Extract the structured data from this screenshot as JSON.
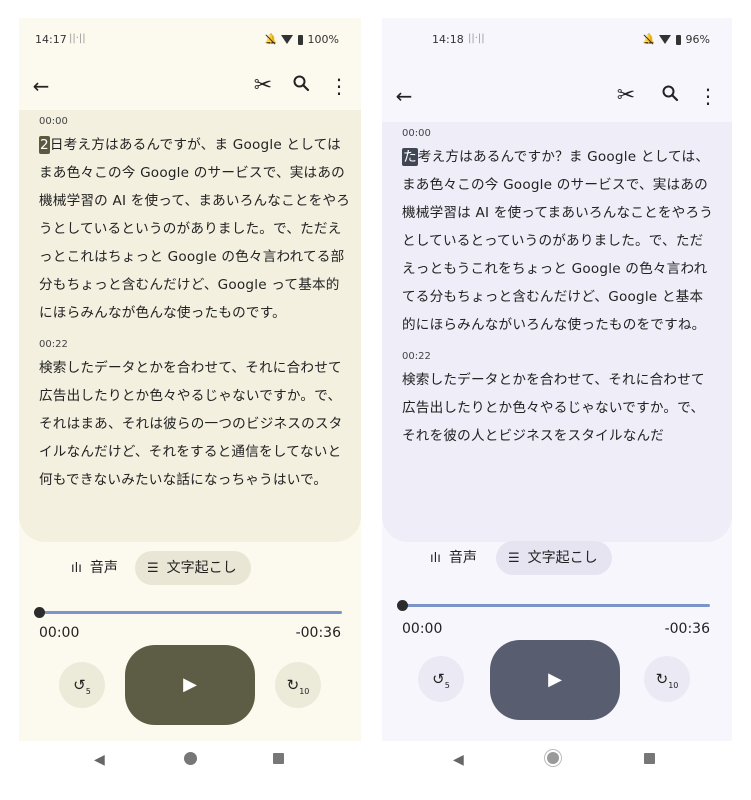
{
  "left": {
    "status": {
      "time": "14:17",
      "vibrate": "||·||",
      "battery": "100%"
    },
    "icons": {
      "back": "arrow-left-icon",
      "cut": "scissors-icon",
      "search": "search-icon",
      "more": "more-vert-icon"
    },
    "segments": [
      {
        "time": "00:00",
        "highlight": "2",
        "text": "日考え方はあるんですが、ま Google としてはまあ色々この今 Google のサービスで、実はあの機械学習の AI を使って、まあいろんなことをやろうとしているというのがありました。で、ただえっとこれはちょっと Google の色々言われてる部分もちょっと含むんだけど、Google って基本的にほらみんなが色んな使ったものです。"
      },
      {
        "time": "00:22",
        "highlight": "",
        "text": "検索したデータとかを合わせて、それに合わせて広告出したりとか色々やるじゃないですか。で、それはまあ、それは彼らの一つのビジネスのスタイルなんだけど、それをすると通信をしてないと何もできないみたいな話になっちゃうはいで。"
      }
    ],
    "tabs": {
      "audio": "音声",
      "transcript": "文字起こし"
    },
    "player": {
      "current": "00:00",
      "remaining": "-00:36",
      "progress": 0.0,
      "rewind_label": "5",
      "forward_label": "10"
    }
  },
  "right": {
    "status": {
      "time": "14:18",
      "vibrate": "||·||",
      "battery": "96%"
    },
    "icons": {
      "back": "arrow-left-icon",
      "cut": "scissors-icon",
      "search": "search-icon",
      "more": "more-vert-icon"
    },
    "segments": [
      {
        "time": "00:00",
        "highlight": "た",
        "text": "考え方はあるんですか？ま Google としては、まあ色々この今 Google のサービスで、実はあの機械学習は AI を使ってまあいろんなことをやろうとしているとっていうのがありました。で、ただえっともうこれをちょっと Google の色々言われてる分もちょっと含むんだけど、Google と基本的にほらみんながいろんな使ったものをですね。"
      },
      {
        "time": "00:22",
        "highlight": "",
        "text": "検索したデータとかを合わせて、それに合わせて広告出したりとか色々やるじゃないですか。で、それを彼の人とビジネスをスタイルなんだ"
      }
    ],
    "tabs": {
      "audio": "音声",
      "transcript": "文字起こし"
    },
    "player": {
      "current": "00:00",
      "remaining": "-00:36",
      "progress": 0.0,
      "rewind_label": "5",
      "forward_label": "10"
    }
  },
  "colors": {
    "left_bg": "#fcfaee",
    "left_card": "#f3f0e0",
    "left_play": "#5d5d45",
    "right_bg": "#f8f6fd",
    "right_card": "#efedf8",
    "right_play": "#585e6f",
    "seek_track": "#7c95c8"
  }
}
